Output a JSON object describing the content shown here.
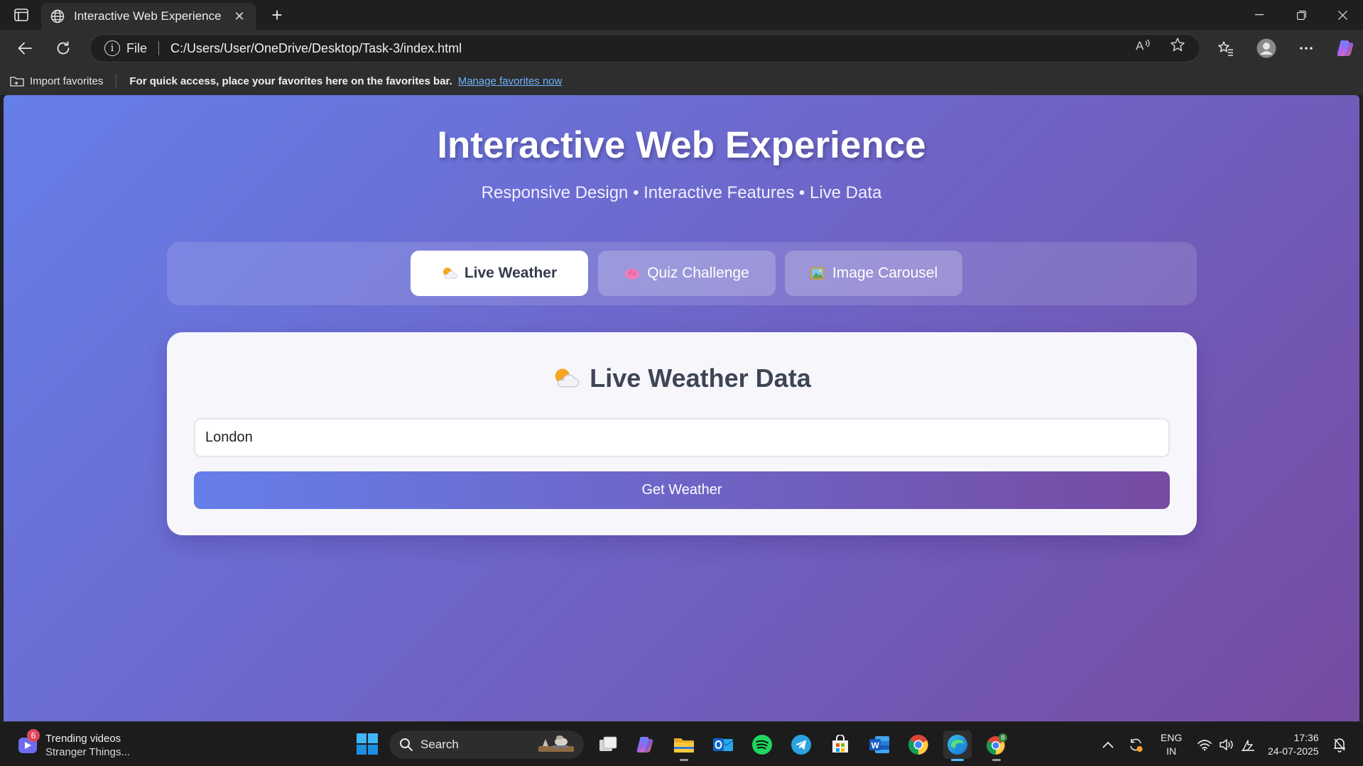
{
  "browser": {
    "tab_title": "Interactive Web Experience",
    "address_scheme": "File",
    "address_url": "C:/Users/User/OneDrive/Desktop/Task-3/index.html",
    "favorites_bar": {
      "import_label": "Import favorites",
      "hint": "For quick access, place your favorites here on the favorites bar.",
      "link": "Manage favorites now"
    }
  },
  "page": {
    "title": "Interactive Web Experience",
    "subtitle": "Responsive Design • Interactive Features • Live Data",
    "tabs": [
      {
        "label": "Live Weather",
        "icon": "sun-behind-cloud-emoji",
        "active": true
      },
      {
        "label": "Quiz Challenge",
        "icon": "brain-emoji",
        "active": false
      },
      {
        "label": "Image Carousel",
        "icon": "framed-picture-emoji",
        "active": false
      }
    ],
    "weather_card": {
      "heading": "Live Weather Data",
      "city_input_value": "London",
      "button_label": "Get Weather"
    },
    "colors": {
      "gradient_start": "#667eea",
      "gradient_end": "#764ba2"
    }
  },
  "taskbar": {
    "widget": {
      "badge": "6",
      "title": "Trending videos",
      "subtitle": "Stranger Things..."
    },
    "search_label": "Search",
    "apps": [
      "task-view",
      "copilot",
      "file-explorer",
      "outlook",
      "spotify",
      "telegram",
      "microsoft-store",
      "word",
      "chrome",
      "edge",
      "chrome-profile"
    ],
    "language": {
      "line1": "ENG",
      "line2": "IN"
    },
    "clock": {
      "time": "17:36",
      "date": "24-07-2025"
    }
  }
}
